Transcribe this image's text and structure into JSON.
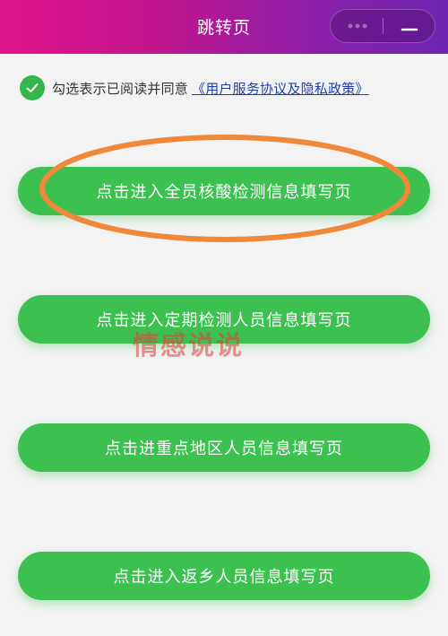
{
  "header": {
    "title": "跳转页",
    "background_gradient": [
      "#e0148a",
      "#6e25b3"
    ],
    "capsule_icons": [
      "more-dots-icon",
      "close-icon"
    ]
  },
  "agreement": {
    "checked": true,
    "prefix": "勾选表示已阅读并同意",
    "link_text": "《用户服务协议及隐私政策》",
    "check_color": "#33b64a",
    "link_color": "#1f3fb0"
  },
  "buttons": [
    {
      "label": "点击进入全员核酸检测信息填写页"
    },
    {
      "label": "点击进入定期检测人员信息填写页"
    },
    {
      "label": "点击进重点地区人员信息填写页"
    },
    {
      "label": "点击进入返乡人员信息填写页"
    }
  ],
  "button_color": "#3cc150",
  "highlight_color": "#f0883a",
  "watermark": "情感说说"
}
